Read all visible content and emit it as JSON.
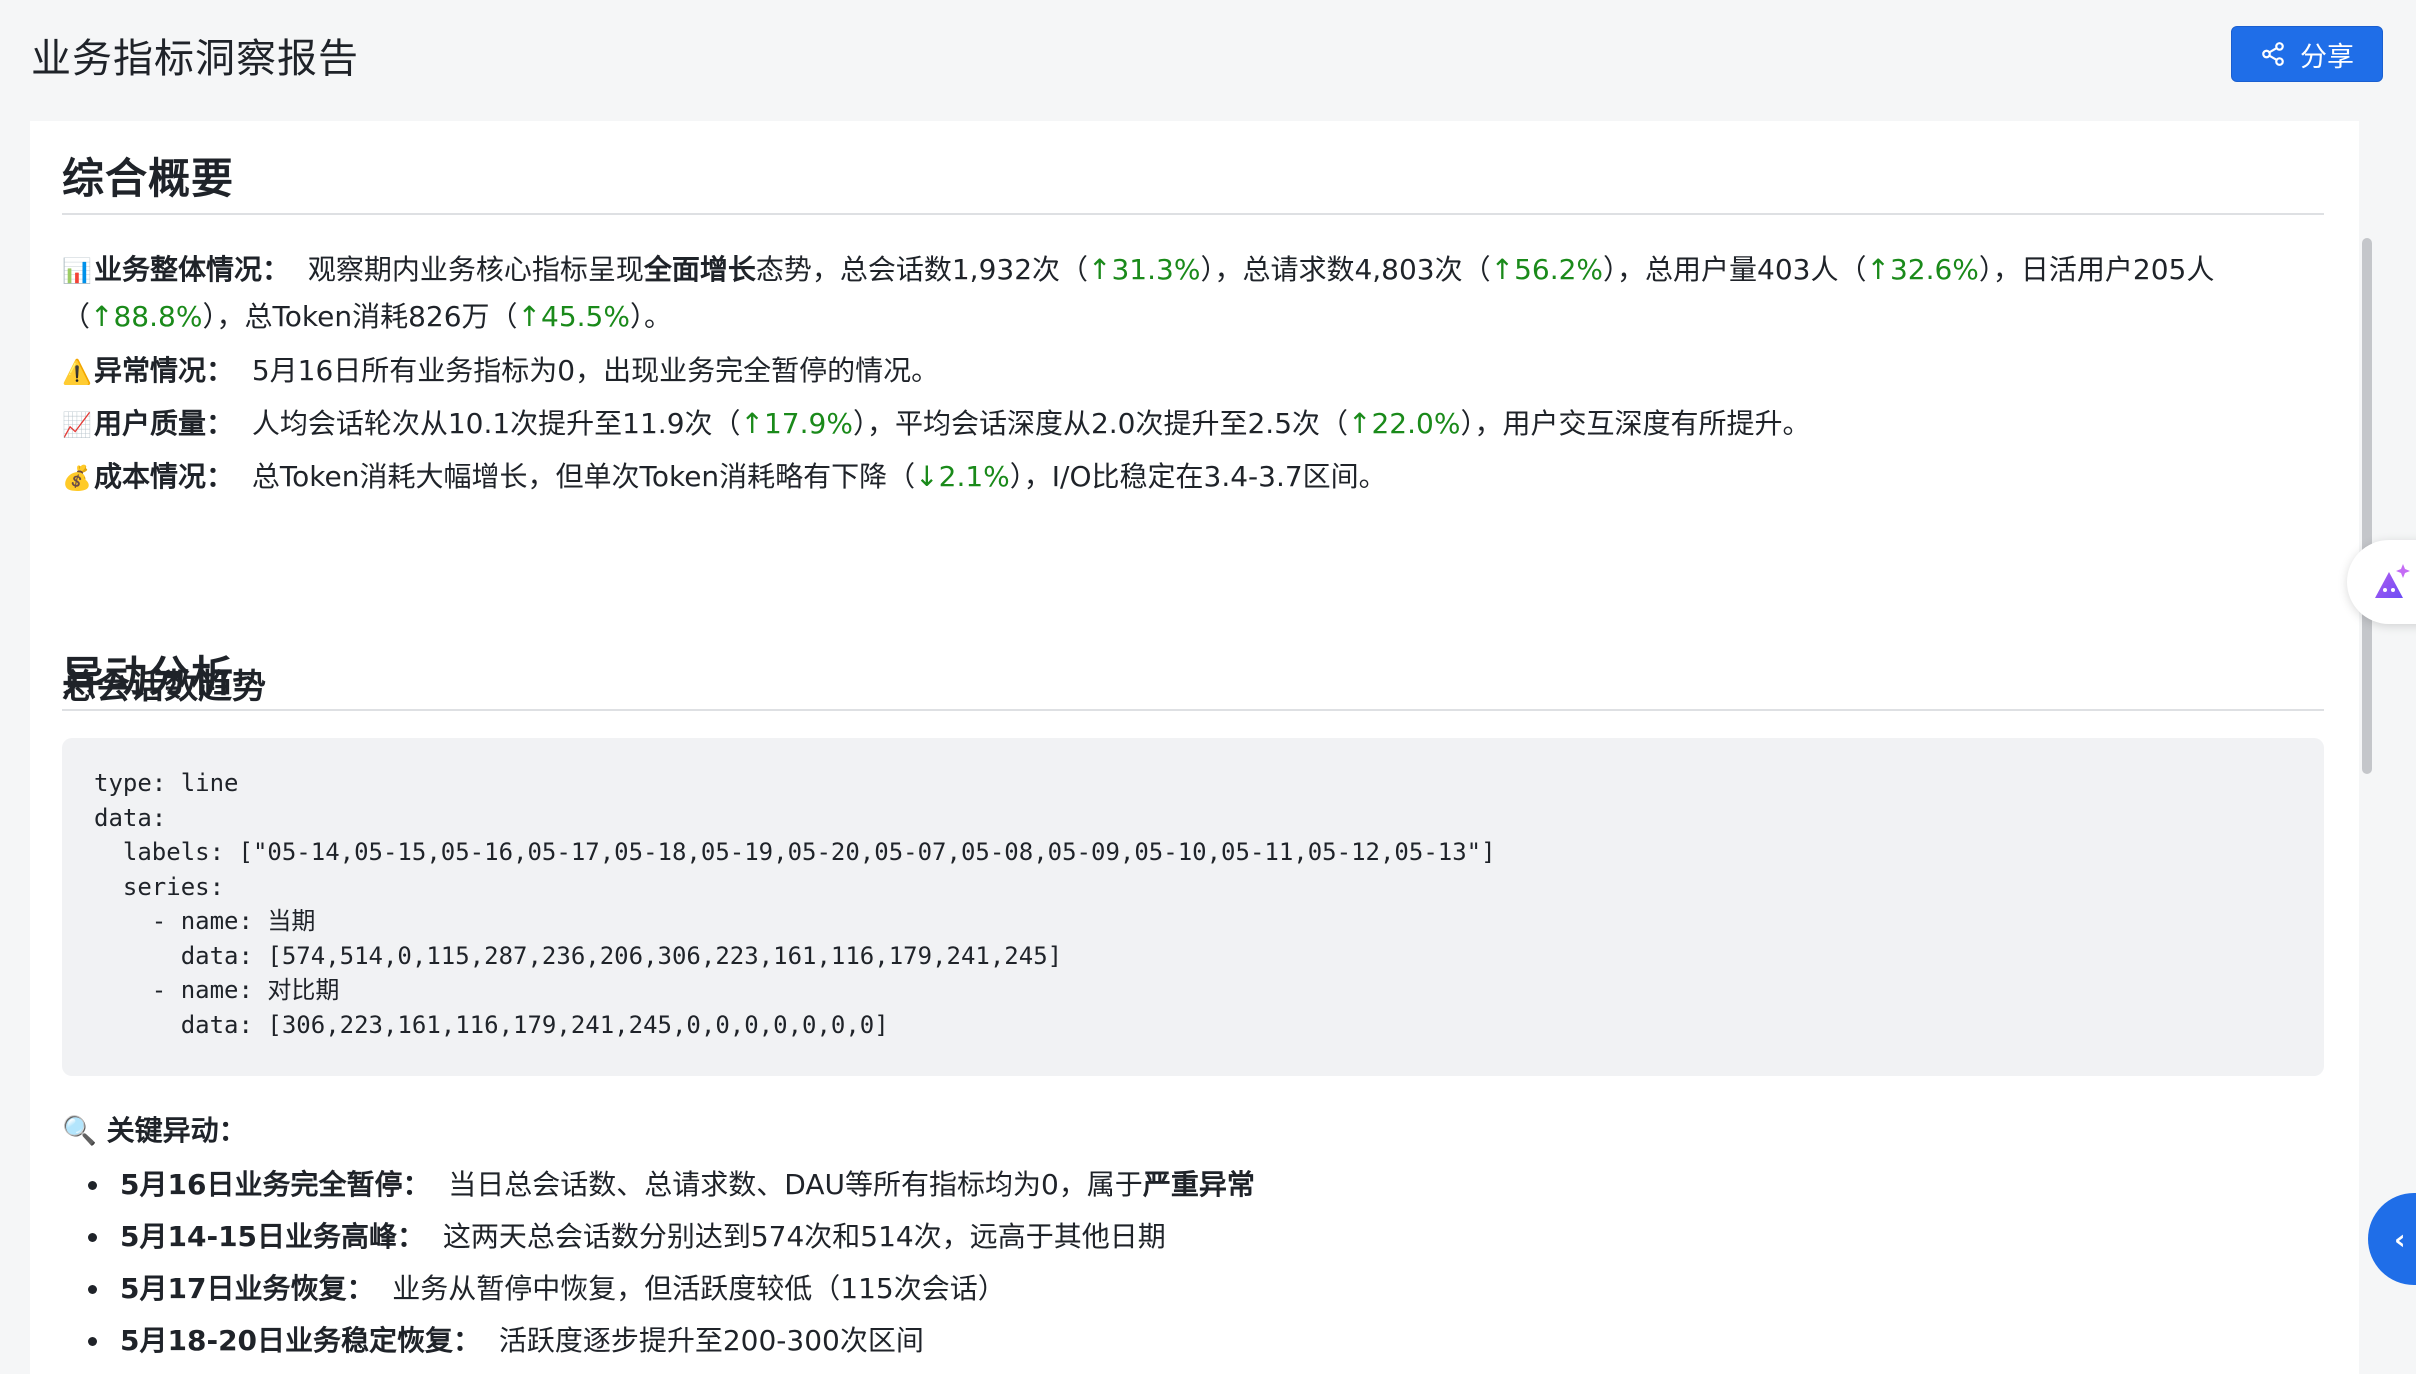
{
  "header": {
    "title": "业务指标洞察报告",
    "share_label": "分享"
  },
  "overview": {
    "heading": "综合概要",
    "items": [
      {
        "emoji": "📊",
        "label": "业务整体情况：",
        "text_a": "观察期内业务核心指标呈现",
        "strong": "全面增长",
        "text_b": "态势，总会话数1,932次（",
        "u1": "↑31.3%",
        "text_c": "），总请求数4,803次（",
        "u2": "↑56.2%",
        "text_d": "），总用户量403人（",
        "u3": "↑32.6%",
        "text_e": "），日活用户205人",
        "text_f": "（",
        "u4": "↑88.8%",
        "text_g": "），总Token消耗826万（",
        "u5": "↑45.5%",
        "text_h": "）。"
      },
      {
        "emoji": "⚠️",
        "label": "异常情况：",
        "text": "5月16日所有业务指标为0，出现业务完全暂停的情况。"
      },
      {
        "emoji": "📈",
        "label": "用户质量：",
        "text_a": "人均会话轮次从10.1次提升至11.9次（",
        "u1": "↑17.9%",
        "text_b": "），平均会话深度从2.0次提升至2.5次（",
        "u2": "↑22.0%",
        "text_c": "），用户交互深度有所提升。"
      },
      {
        "emoji": "💰",
        "label": "成本情况：",
        "text_a": "总Token消耗大幅增长，但单次Token消耗略有下降（",
        "d1": "↓2.1%",
        "text_b": "），I/O比稳定在3.4-3.7区间。"
      }
    ]
  },
  "anomaly": {
    "heading": "异动分析",
    "subheading": "总会话数趋势",
    "code_lines": [
      "type: line",
      "data:",
      "  labels: [\"05-14,05-15,05-16,05-17,05-18,05-19,05-20,05-07,05-08,05-09,05-10,05-11,05-12,05-13\"]",
      "  series:",
      "    - name: 当期",
      "      data: [574,514,0,115,287,236,206,306,223,161,116,179,241,245]",
      "    - name: 对比期",
      "      data: [306,223,161,116,179,241,245,0,0,0,0,0,0,0]"
    ],
    "key_title": "🔍 关键异动：",
    "key_items": [
      {
        "title": "5月16日业务完全暂停：",
        "text": "当日总会话数、总请求数、DAU等所有指标均为0，属于",
        "strong": "严重异常"
      },
      {
        "title": "5月14-15日业务高峰：",
        "text": "这两天总会话数分别达到574次和514次，远高于其他日期",
        "strong": ""
      },
      {
        "title": "5月17日业务恢复：",
        "text": "业务从暂停中恢复，但活跃度较低（115次会话）",
        "strong": ""
      },
      {
        "title": "5月18-20日业务稳定恢复：",
        "text": "活跃度逐步提升至200-300次区间",
        "strong": ""
      }
    ]
  },
  "colors": {
    "accent": "#1f6ee8",
    "increase": "#1a8a1a"
  },
  "icons": {
    "share": "share-icon",
    "ai_assistant": "ai-assistant-icon",
    "collapse": "chevron-left-icon"
  },
  "float": {
    "collapse_glyph": "‹"
  }
}
